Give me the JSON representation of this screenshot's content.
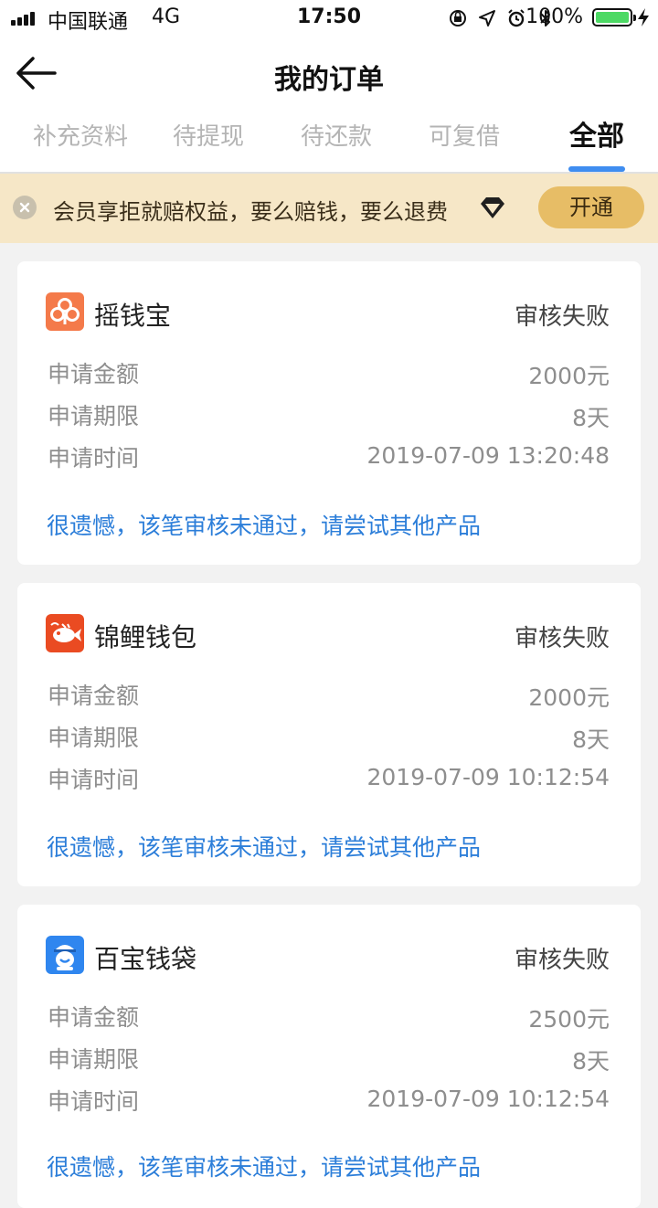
{
  "status_bar": {
    "carrier": "中国联通",
    "network": "4G",
    "time": "17:50",
    "battery_percent": "100%",
    "battery_color": "#4cd964"
  },
  "header": {
    "title": "我的订单",
    "back_icon": "arrow-left-icon"
  },
  "tabs": [
    {
      "label": "补充资料",
      "active": false
    },
    {
      "label": "待提现",
      "active": false
    },
    {
      "label": "待还款",
      "active": false
    },
    {
      "label": "可复借",
      "active": false
    },
    {
      "label": "全部",
      "active": true
    }
  ],
  "accent_color": "#3f8df0",
  "banner": {
    "text": "会员享拒就赔权益，要么赔钱，要么退费",
    "button_label": "开通",
    "background": "#f6e7c7",
    "button_color": "#e7bd66"
  },
  "orders": [
    {
      "name": "摇钱宝",
      "status": "审核失败",
      "logo": "clover-logo-icon",
      "logo_color": "#f47a4a",
      "rows": [
        {
          "label": "申请金额",
          "value": "2000元"
        },
        {
          "label": "申请期限",
          "value": "8天"
        },
        {
          "label": "申请时间",
          "value": "2019-07-09 13:20:48"
        }
      ],
      "message": "很遗憾，该笔审核未通过，请尝试其他产品"
    },
    {
      "name": "锦鲤钱包",
      "status": "审核失败",
      "logo": "koi-fish-logo-icon",
      "logo_color": "#ea4b22",
      "rows": [
        {
          "label": "申请金额",
          "value": "2000元"
        },
        {
          "label": "申请期限",
          "value": "8天"
        },
        {
          "label": "申请时间",
          "value": "2019-07-09 10:12:54"
        }
      ],
      "message": "很遗憾，该笔审核未通过，请尝试其他产品"
    },
    {
      "name": "百宝钱袋",
      "status": "审核失败",
      "logo": "mascot-face-logo-icon",
      "logo_color": "#2f86ef",
      "rows": [
        {
          "label": "申请金额",
          "value": "2500元"
        },
        {
          "label": "申请期限",
          "value": "8天"
        },
        {
          "label": "申请时间",
          "value": "2019-07-09 10:12:54"
        }
      ],
      "message": "很遗憾，该笔审核未通过，请尝试其他产品"
    }
  ]
}
